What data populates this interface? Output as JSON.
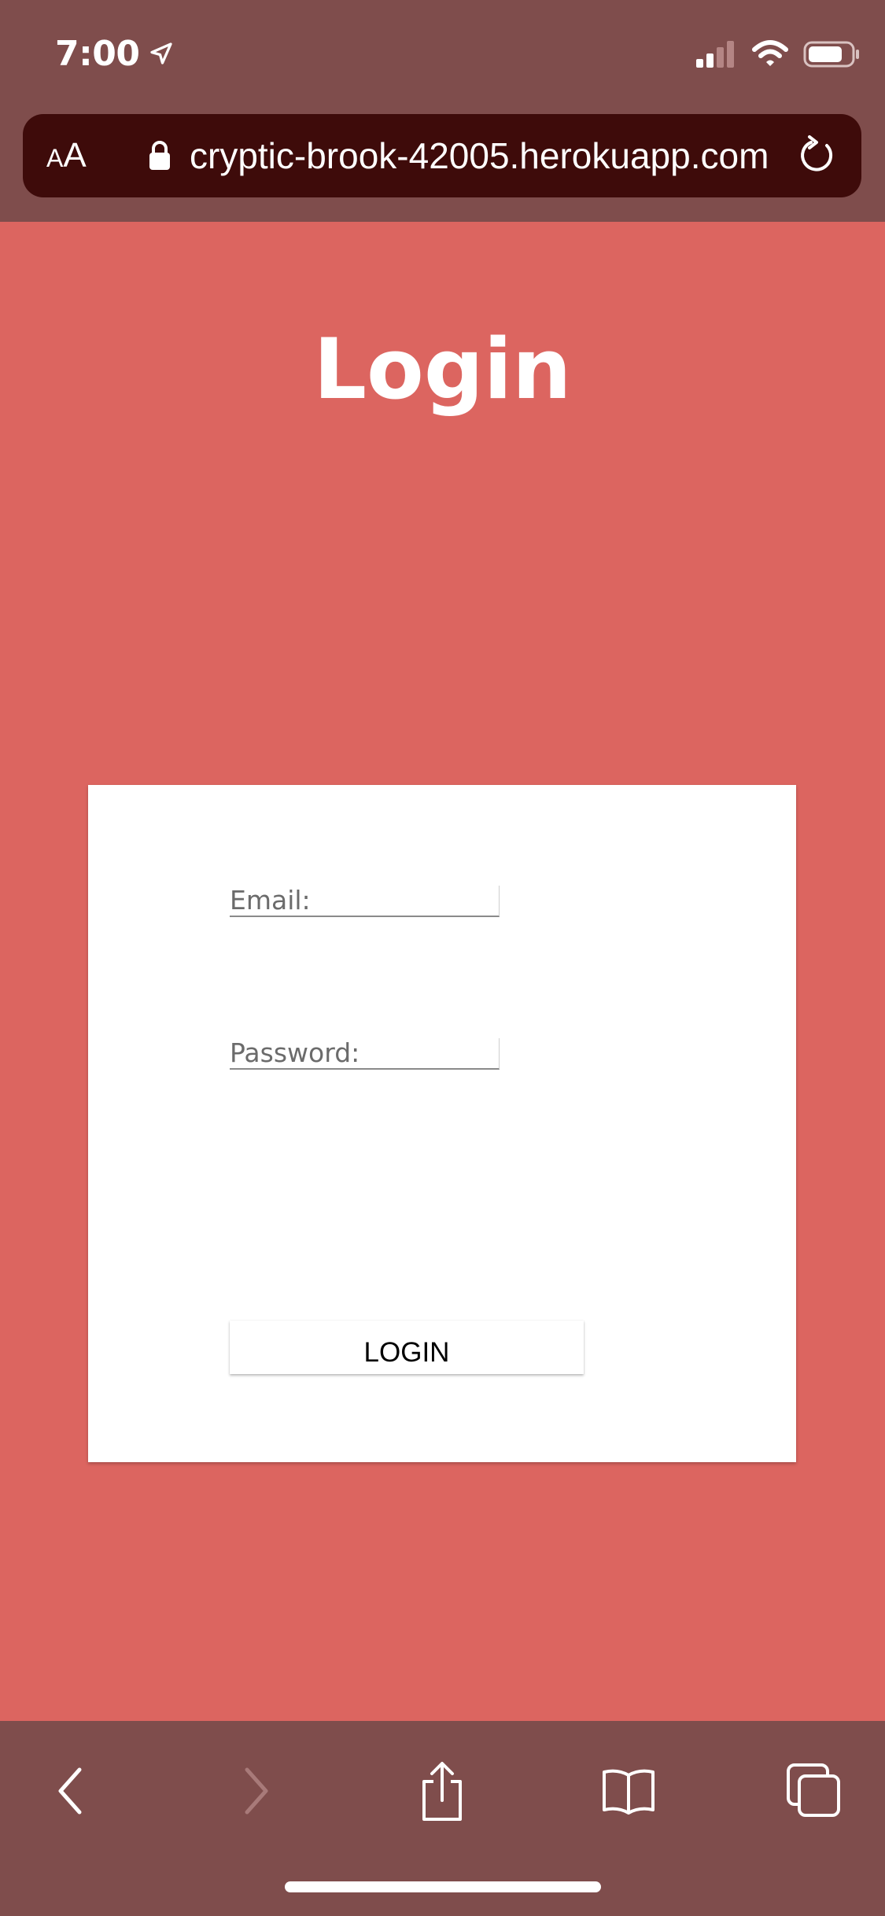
{
  "status_bar": {
    "time": "7:00"
  },
  "browser": {
    "text_size_small": "A",
    "text_size_large": "A",
    "url": "cryptic-brook-42005.herokuapp.com"
  },
  "page": {
    "title": "Login",
    "email_placeholder": "Email:",
    "password_placeholder": "Password:",
    "login_button": "LOGIN"
  },
  "toolbar": {
    "icons": [
      "back-icon",
      "forward-icon",
      "share-icon",
      "bookmarks-icon",
      "tabs-icon"
    ]
  },
  "colors": {
    "page_background": "#dc6560",
    "chrome_background": "#7f4d4c",
    "url_bar_background": "#3e0b0a",
    "card_background": "#ffffff"
  }
}
